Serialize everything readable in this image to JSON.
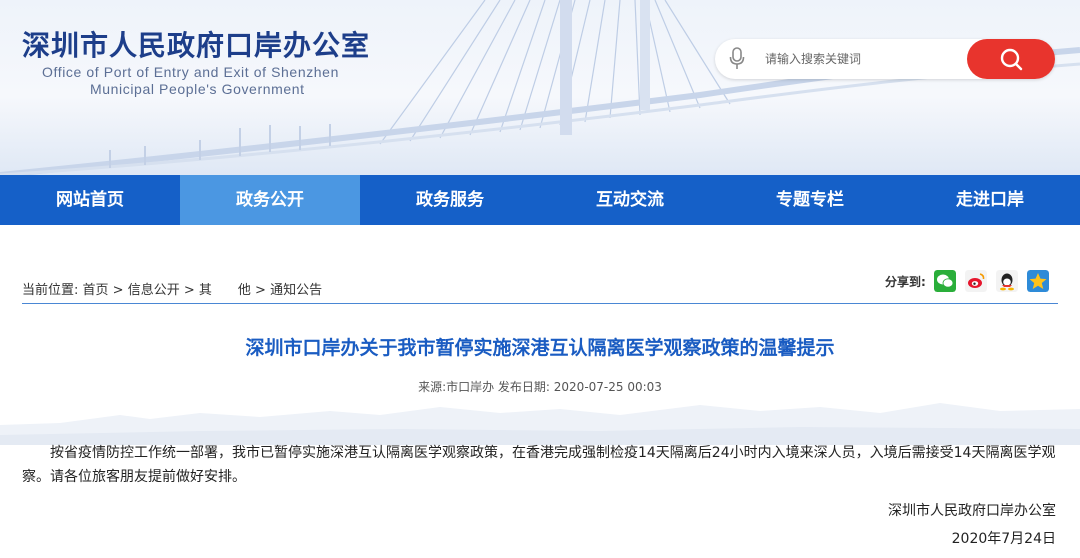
{
  "header": {
    "title": "深圳市人民政府口岸办公室",
    "english_line1": "Office of Port of Entry and Exit of Shenzhen",
    "english_line2": "Municipal People's Government",
    "search_placeholder": "请输入搜索关键词",
    "mic_icon": "microphone-icon",
    "search_icon": "search-icon",
    "search_button_color": "#e8342d"
  },
  "nav": {
    "items": [
      {
        "label": "网站首页"
      },
      {
        "label": "政务公开",
        "active": true
      },
      {
        "label": "政务服务"
      },
      {
        "label": "互动交流"
      },
      {
        "label": "专题专栏"
      },
      {
        "label": "走进口岸"
      }
    ],
    "color": "#1560c8",
    "active_color": "#4b97e2"
  },
  "breadcrumb": {
    "prefix": "当前位置:",
    "items": [
      "首页",
      "信息公开",
      "其　　他",
      "通知公告"
    ],
    "separator": " > "
  },
  "share": {
    "label": "分享到:",
    "icons": [
      "wechat-icon",
      "weibo-icon",
      "qq-icon",
      "qzone-icon"
    ]
  },
  "article": {
    "title": "深圳市口岸办关于我市暂停实施深港互认隔离医学观察政策的温馨提示",
    "meta": "来源:市口岸办 发布日期: 2020-07-25 00:03",
    "body": "按省疫情防控工作统一部署，我市已暂停实施深港互认隔离医学观察政策，在香港完成强制检疫14天隔离后24小时内入境来深人员，入境后需接受14天隔离医学观察。请各位旅客朋友提前做好安排。",
    "signature": "深圳市人民政府口岸办公室",
    "date": "2020年7月24日"
  }
}
